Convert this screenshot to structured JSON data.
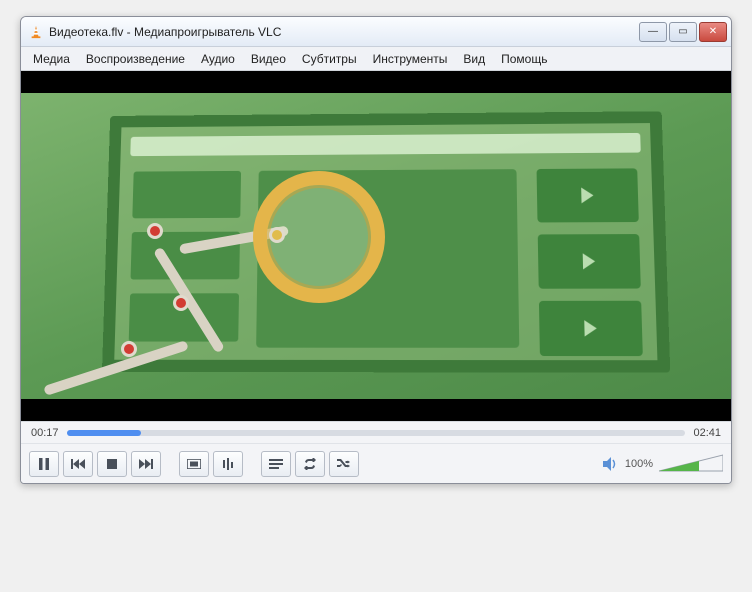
{
  "title": "Видеотека.flv - Медиапроигрыватель VLC",
  "menu": {
    "media": "Медиа",
    "playback": "Воспроизведение",
    "audio": "Аудио",
    "video": "Видео",
    "subtitle": "Субтитры",
    "tools": "Инструменты",
    "view": "Вид",
    "help": "Помощь"
  },
  "time": {
    "current": "00:17",
    "total": "02:41"
  },
  "volume": {
    "percent": "100%"
  },
  "icons": {
    "minimize": "—",
    "maximize": "▭",
    "close": "✕"
  }
}
